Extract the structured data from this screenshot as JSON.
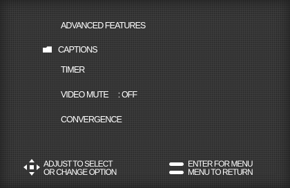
{
  "menu": {
    "title": "ADVANCED FEATURES",
    "items": [
      {
        "label": "CAPTIONS",
        "selected": true
      },
      {
        "label": "TIMER"
      },
      {
        "label": "VIDEO MUTE",
        "value": ": OFF"
      },
      {
        "label": "CONVERGENCE"
      }
    ]
  },
  "help": {
    "adjust_line1": "ADJUST TO SELECT",
    "adjust_line2": "OR CHANGE OPTION",
    "enter_line1": "ENTER FOR MENU",
    "enter_line2": "MENU TO RETURN"
  },
  "icons": {
    "selector": "folder-marker-icon",
    "navigation": "four-way-arrows-icon",
    "enter_menu": "enter-button-icon",
    "menu_return": "menu-button-icon"
  },
  "colors": {
    "background": "#3c3c3c",
    "text": "#ffffff"
  }
}
